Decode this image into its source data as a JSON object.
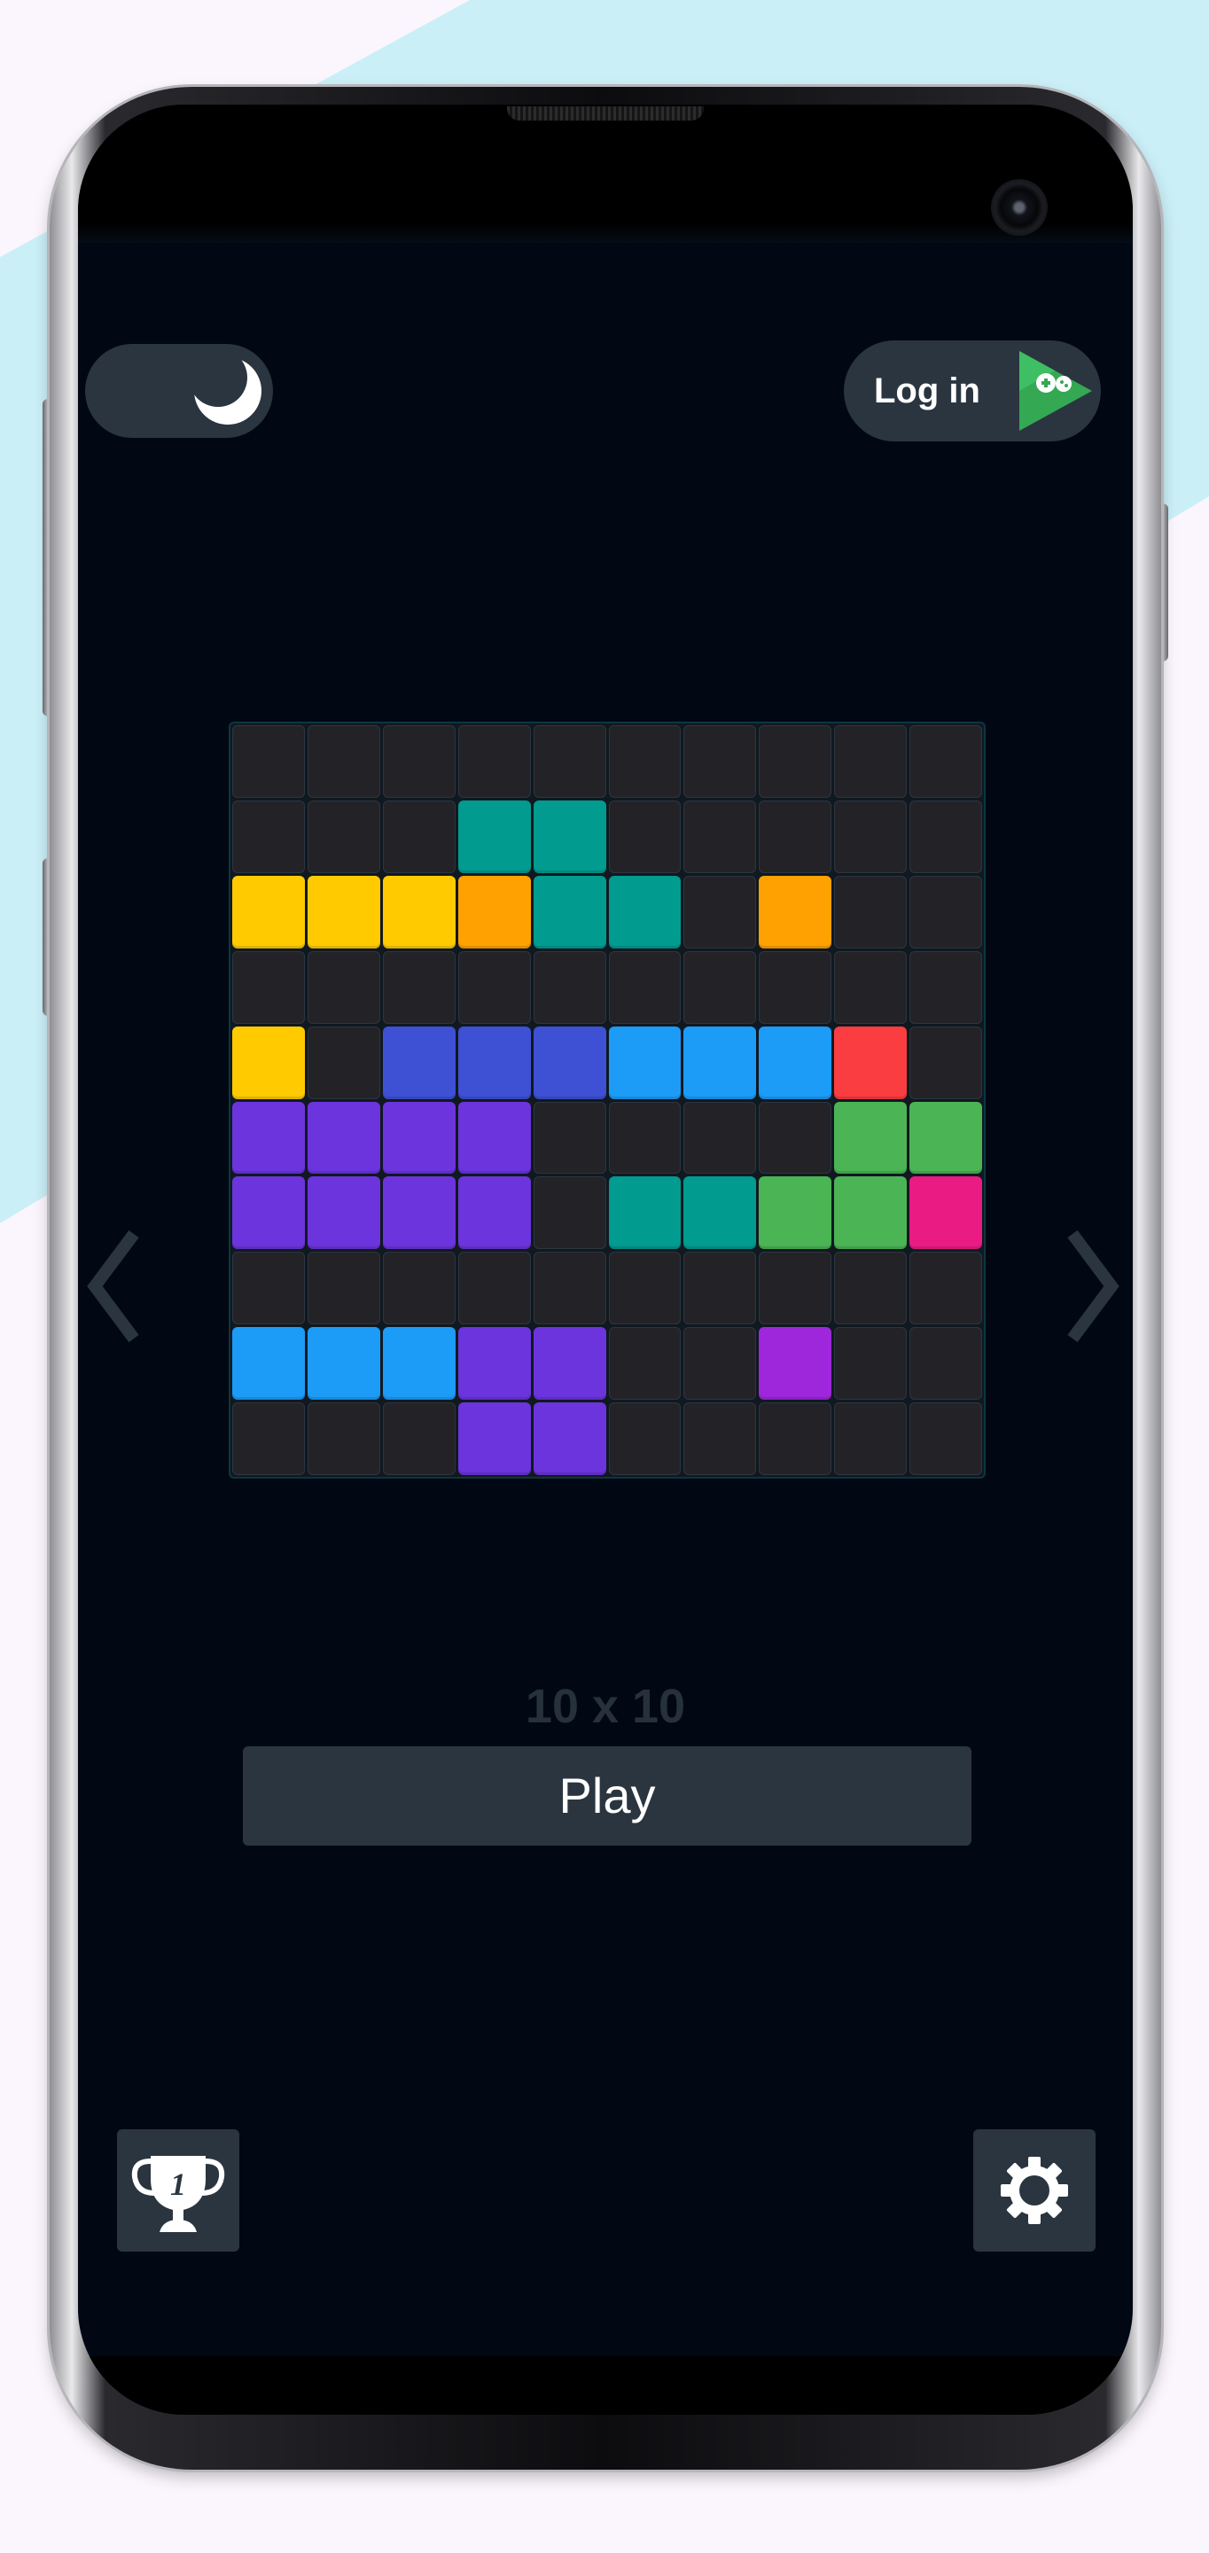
{
  "header": {
    "theme_toggle": {
      "mode": "dark",
      "icon": "moon-icon"
    },
    "login": {
      "label": "Log in",
      "icon": "google-play-games-icon"
    }
  },
  "board": {
    "rows": 10,
    "cols": 10,
    "empty_color": "#232327",
    "grid": [
      [
        null,
        null,
        null,
        null,
        null,
        null,
        null,
        null,
        null,
        null
      ],
      [
        null,
        null,
        null,
        "#019b90",
        "#019b90",
        null,
        null,
        null,
        null,
        null
      ],
      [
        "#ffcb00",
        "#ffcb00",
        "#ffcb00",
        "#ffa100",
        "#019b90",
        "#019b90",
        null,
        "#ffa100",
        null,
        null
      ],
      [
        null,
        null,
        null,
        null,
        null,
        null,
        null,
        null,
        null,
        null
      ],
      [
        "#ffcb00",
        null,
        "#3e50d3",
        "#3e50d3",
        "#3e50d3",
        "#1c9bf7",
        "#1c9bf7",
        "#1c9bf7",
        "#fa3d40",
        null
      ],
      [
        "#6c34dc",
        "#6c34dc",
        "#6c34dc",
        "#6c34dc",
        null,
        null,
        null,
        null,
        "#4bb455",
        "#4bb455"
      ],
      [
        "#6c34dc",
        "#6c34dc",
        "#6c34dc",
        "#6c34dc",
        null,
        "#019b90",
        "#019b90",
        "#4bb455",
        "#4bb455",
        "#ea1c83"
      ],
      [
        null,
        null,
        null,
        null,
        null,
        null,
        null,
        null,
        null,
        null
      ],
      [
        "#1c9bf7",
        "#1c9bf7",
        "#1c9bf7",
        "#6c34dc",
        "#6c34dc",
        null,
        null,
        "#9f27db",
        null,
        null
      ],
      [
        null,
        null,
        null,
        "#6c34dc",
        "#6c34dc",
        null,
        null,
        null,
        null,
        null
      ]
    ]
  },
  "navigation": {
    "prev_icon": "chevron-left-icon",
    "next_icon": "chevron-right-icon"
  },
  "size_label": "10 x 10",
  "play_label": "Play",
  "footer": {
    "trophy_icon": "trophy-icon",
    "trophy_number": "1",
    "settings_icon": "gear-icon"
  },
  "colors": {
    "screen_background": "#010813",
    "button_background": "#2a3540",
    "accent_teal": "#019b90"
  }
}
